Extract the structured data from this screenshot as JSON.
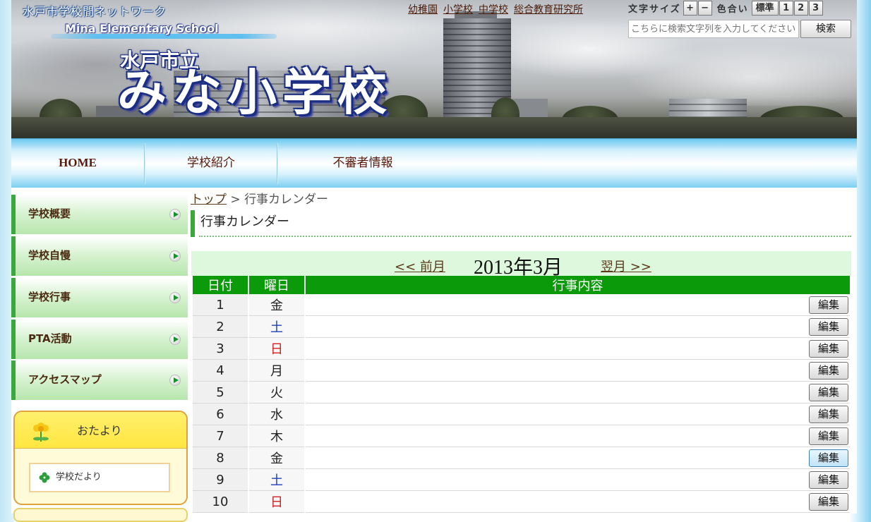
{
  "header": {
    "network_title": "水戸市学校間ネットワーク",
    "english_name": "Mina Elementary School",
    "city": "水戸市立",
    "school_name": "みな小学校",
    "top_links": [
      "幼稚園",
      "小学校",
      "中学校",
      "総合教育研究所"
    ],
    "font_size_label": "文字サイズ",
    "font_plus": "+",
    "font_minus": "−",
    "color_label": "色合い",
    "color_standard": "標準",
    "color_options": [
      "1",
      "2",
      "3"
    ],
    "search_placeholder": "こちらに検索文字列を入力してください",
    "search_button": "検索"
  },
  "nav": {
    "items": [
      "HOME",
      "学校紹介",
      "不審者情報"
    ]
  },
  "sidebar": {
    "items": [
      "学校概要",
      "学校自慢",
      "学校行事",
      "PTA活動",
      "アクセスマップ"
    ],
    "otayori_title": "おたより",
    "otayori_link": "学校だより"
  },
  "breadcrumb": {
    "top": "トップ",
    "separator": ">",
    "current": "行事カレンダー"
  },
  "page_title": "行事カレンダー",
  "calendar": {
    "prev": "<< 前月",
    "month": "2013年3月",
    "next": "翌月 >>",
    "headers": [
      "日付",
      "曜日",
      "行事内容"
    ],
    "edit_label": "編集",
    "rows": [
      {
        "day": "1",
        "weekday": "金"
      },
      {
        "day": "2",
        "weekday": "土"
      },
      {
        "day": "3",
        "weekday": "日"
      },
      {
        "day": "4",
        "weekday": "月"
      },
      {
        "day": "5",
        "weekday": "火"
      },
      {
        "day": "6",
        "weekday": "水"
      },
      {
        "day": "7",
        "weekday": "木"
      },
      {
        "day": "8",
        "weekday": "金"
      },
      {
        "day": "9",
        "weekday": "土"
      },
      {
        "day": "10",
        "weekday": "日"
      }
    ]
  },
  "colors": {
    "accent_green": "#0a9a0a",
    "saturday": "#1f3fb8",
    "sunday": "#d02020",
    "nav_text": "#5a1b0c"
  }
}
